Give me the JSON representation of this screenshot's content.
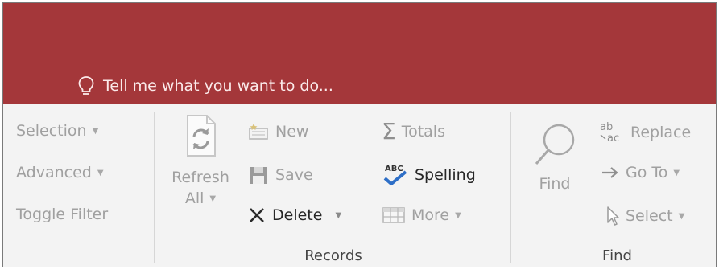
{
  "tellme": {
    "placeholder": "Tell me what you want to do..."
  },
  "sort_filter": {
    "selection": "Selection",
    "advanced": "Advanced",
    "toggle_filter": "Toggle Filter"
  },
  "records": {
    "refresh_line1": "Refresh",
    "refresh_line2": "All",
    "new": "New",
    "save": "Save",
    "delete": "Delete",
    "totals": "Totals",
    "spelling": "Spelling",
    "more": "More",
    "group_label": "Records"
  },
  "find": {
    "find": "Find",
    "replace": "Replace",
    "go_to": "Go To",
    "select": "Select",
    "group_label": "Find"
  },
  "colors": {
    "title_bar": "#a4373a",
    "ribbon_bg": "#f3f3f3",
    "disabled_text": "#a0a0a0",
    "enabled_text": "#262626",
    "spelling_check": "#2e6fc7"
  },
  "icons": {
    "tellme": "lightbulb-icon",
    "refresh": "refresh-icon",
    "new": "new-record-icon",
    "save": "save-icon",
    "delete": "delete-x-icon",
    "totals": "sigma-icon",
    "spelling": "spelling-check-icon",
    "more": "more-grid-icon",
    "find": "magnifier-icon",
    "replace": "replace-icon",
    "go_to": "arrow-right-icon",
    "select": "cursor-icon"
  }
}
